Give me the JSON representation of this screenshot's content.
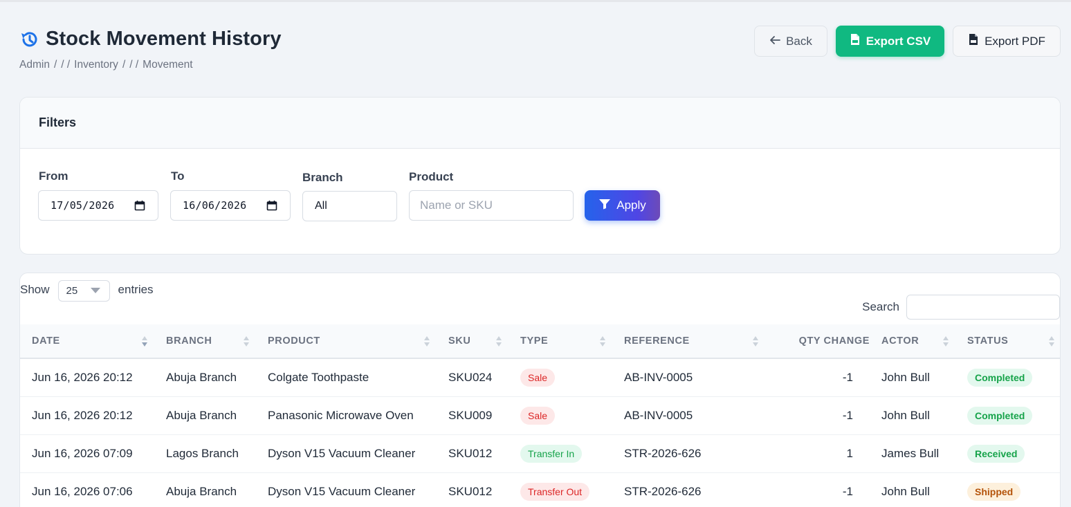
{
  "page": {
    "title": "Stock Movement History",
    "title_icon": "history-icon",
    "breadcrumb": [
      "Admin",
      "/",
      "/ /",
      "Inventory",
      "/",
      "/ /",
      "Movement"
    ]
  },
  "actions": {
    "back_label": "Back",
    "export_csv_label": "Export CSV",
    "export_pdf_label": "Export PDF"
  },
  "filters": {
    "title": "Filters",
    "from_label": "From",
    "from_value": "17/05/2026",
    "to_label": "To",
    "to_value": "16/06/2026",
    "branch_label": "Branch",
    "branch_value": "All",
    "product_label": "Product",
    "product_placeholder": "Name or SKU",
    "apply_label": "Apply"
  },
  "table": {
    "show_label": "Show",
    "page_size": "25",
    "entries_label": "entries",
    "search_label": "Search",
    "columns": [
      "DATE",
      "BRANCH",
      "PRODUCT",
      "SKU",
      "TYPE",
      "REFERENCE",
      "QTY CHANGE",
      "ACTOR",
      "STATUS"
    ],
    "rows": [
      {
        "date": "Jun 16, 2026 20:12",
        "branch": "Abuja Branch",
        "product": "Colgate Toothpaste",
        "sku": "SKU024",
        "type": "Sale",
        "reference": "AB-INV-0005",
        "qty": "-1",
        "actor": "John Bull",
        "status": "Completed"
      },
      {
        "date": "Jun 16, 2026 20:12",
        "branch": "Abuja Branch",
        "product": "Panasonic Microwave Oven",
        "sku": "SKU009",
        "type": "Sale",
        "reference": "AB-INV-0005",
        "qty": "-1",
        "actor": "John Bull",
        "status": "Completed"
      },
      {
        "date": "Jun 16, 2026 07:09",
        "branch": "Lagos Branch",
        "product": "Dyson V15 Vacuum Cleaner",
        "sku": "SKU012",
        "type": "Transfer In",
        "reference": "STR-2026-626",
        "qty": "1",
        "actor": "James Bull",
        "status": "Received"
      },
      {
        "date": "Jun 16, 2026 07:06",
        "branch": "Abuja Branch",
        "product": "Dyson V15 Vacuum Cleaner",
        "sku": "SKU012",
        "type": "Transfer Out",
        "reference": "STR-2026-626",
        "qty": "-1",
        "actor": "John Bull",
        "status": "Shipped"
      }
    ]
  },
  "colors": {
    "accent": "#10b981",
    "primary": "#2563eb",
    "title_icon": "#1d72e8",
    "danger": "#dc2626",
    "success": "#16a34a",
    "warning": "#b45309"
  }
}
